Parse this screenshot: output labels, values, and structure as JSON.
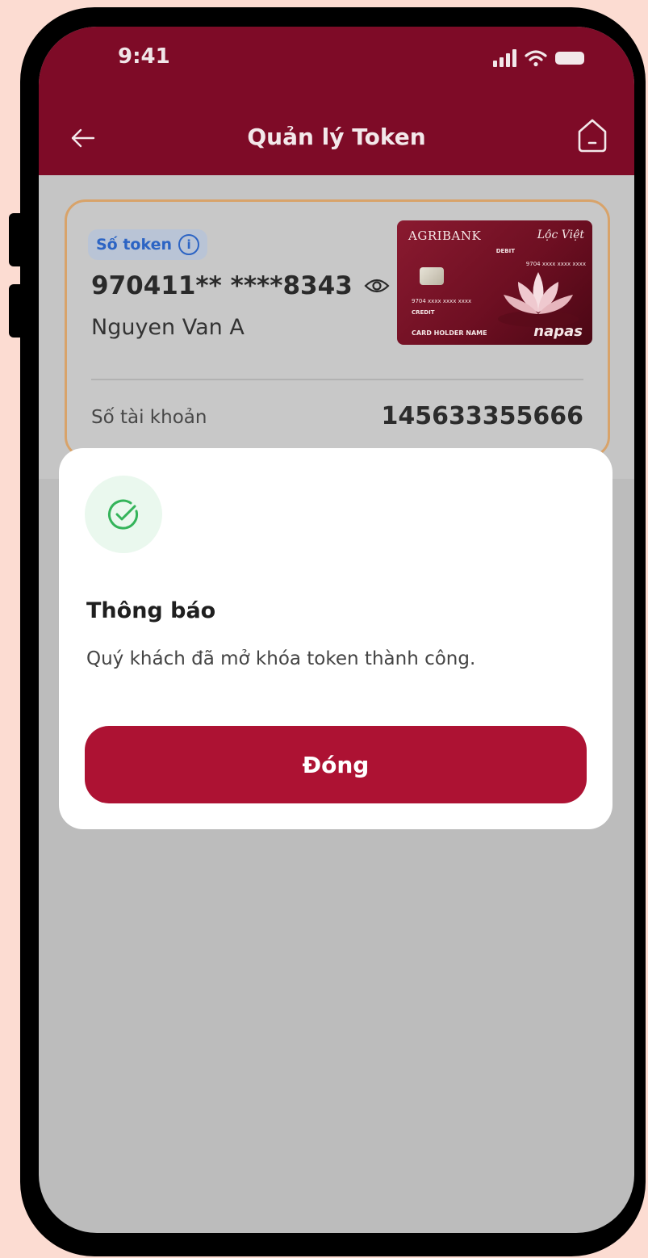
{
  "status_bar": {
    "time": "9:41"
  },
  "header": {
    "title": "Quản lý Token"
  },
  "token_card": {
    "badge_label": "Số token",
    "info_glyph": "i",
    "token_number": "970411** ****8343",
    "holder_name": "Nguyen Van A",
    "account_label": "Số tài khoản",
    "account_number": "145633355666"
  },
  "bank_card": {
    "bank_name": "AGRIBANK",
    "brand": "Lộc Việt",
    "debit_label": "DEBIT",
    "debit_number": "9704 xxxx xxxx xxxx",
    "credit_number": "9704 xxxx xxxx xxxx",
    "credit_label": "CREDIT",
    "holder_label": "CARD HOLDER NAME",
    "network": "napas"
  },
  "modal": {
    "title": "Thông báo",
    "message": "Quý khách đã mở khóa token thành công.",
    "close_label": "Đóng"
  },
  "colors": {
    "brand_primary": "#7e0b27",
    "button": "#ad1233",
    "success": "#34b45a",
    "badge_text": "#2c64c4",
    "card_border": "#d8a36a"
  },
  "icons": [
    "back-arrow-icon",
    "home-icon",
    "info-icon",
    "eye-icon",
    "check-circle-icon",
    "signal-icon",
    "wifi-icon",
    "battery-icon"
  ]
}
